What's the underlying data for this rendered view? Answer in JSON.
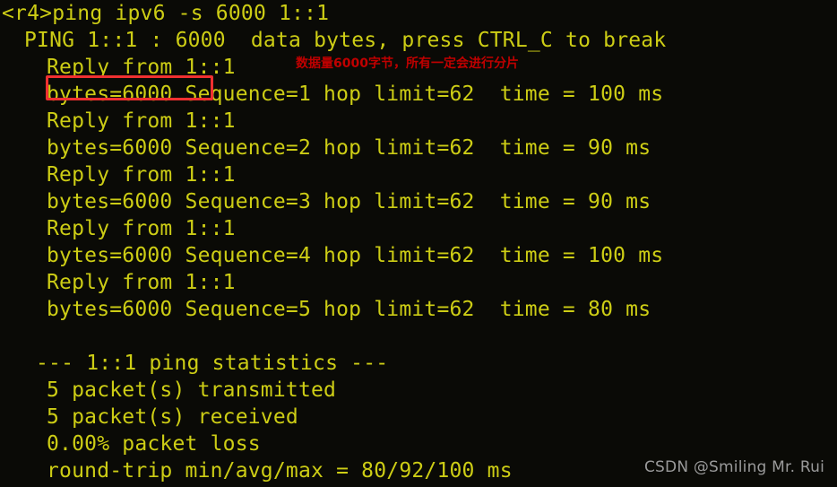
{
  "terminal": {
    "background_color": "#0a0a06",
    "text_color": "#cdcd15",
    "prompt": "<r4>",
    "lines": [
      {
        "indent": 0,
        "text": "<r4>ping ipv6 -s 6000 1::1"
      },
      {
        "indent": 1,
        "text": "PING 1::1 : 6000  data bytes, press CTRL_C to break"
      },
      {
        "indent": 2,
        "text": "Reply from 1::1"
      },
      {
        "indent": 2,
        "text": "bytes=6000 Sequence=1 hop limit=62  time = 100 ms"
      },
      {
        "indent": 2,
        "text": "Reply from 1::1"
      },
      {
        "indent": 2,
        "text": "bytes=6000 Sequence=2 hop limit=62  time = 90 ms"
      },
      {
        "indent": 2,
        "text": "Reply from 1::1"
      },
      {
        "indent": 2,
        "text": "bytes=6000 Sequence=3 hop limit=62  time = 90 ms"
      },
      {
        "indent": 2,
        "text": "Reply from 1::1"
      },
      {
        "indent": 2,
        "text": "bytes=6000 Sequence=4 hop limit=62  time = 100 ms"
      },
      {
        "indent": 2,
        "text": "Reply from 1::1"
      },
      {
        "indent": 2,
        "text": "bytes=6000 Sequence=5 hop limit=62  time = 80 ms"
      },
      {
        "indent": 0,
        "text": ""
      },
      {
        "indent": 3,
        "text": "--- 1::1 ping statistics ---"
      },
      {
        "indent": 2,
        "text": "5 packet(s) transmitted"
      },
      {
        "indent": 2,
        "text": "5 packet(s) received"
      },
      {
        "indent": 2,
        "text": "0.00% packet loss"
      },
      {
        "indent": 2,
        "text": "round-trip min/avg/max = 80/92/100 ms"
      }
    ]
  },
  "ping_summary": {
    "command": "ping ipv6 -s 6000 1::1",
    "target": "1::1",
    "data_bytes": "6000",
    "break_key": "CTRL_C",
    "replies": [
      {
        "sequence": "1",
        "bytes": "6000",
        "hop_limit": "62",
        "time": "100 ms"
      },
      {
        "sequence": "2",
        "bytes": "6000",
        "hop_limit": "62",
        "time": "90 ms"
      },
      {
        "sequence": "3",
        "bytes": "6000",
        "hop_limit": "62",
        "time": "90 ms"
      },
      {
        "sequence": "4",
        "bytes": "6000",
        "hop_limit": "62",
        "time": "100 ms"
      },
      {
        "sequence": "5",
        "bytes": "6000",
        "hop_limit": "62",
        "time": "80 ms"
      }
    ],
    "transmitted": "5",
    "received": "5",
    "packet_loss": "0.00%",
    "round_trip": "80/92/100 ms"
  },
  "annotation": {
    "text": "数据量6000字节，所有一定会进行分片",
    "color": "#c00000"
  },
  "highlight": {
    "target_text": "bytes=6000",
    "color": "#f03030"
  },
  "watermark": {
    "text": "CSDN @Smiling Mr. Rui",
    "color": "#9a9a9a"
  }
}
